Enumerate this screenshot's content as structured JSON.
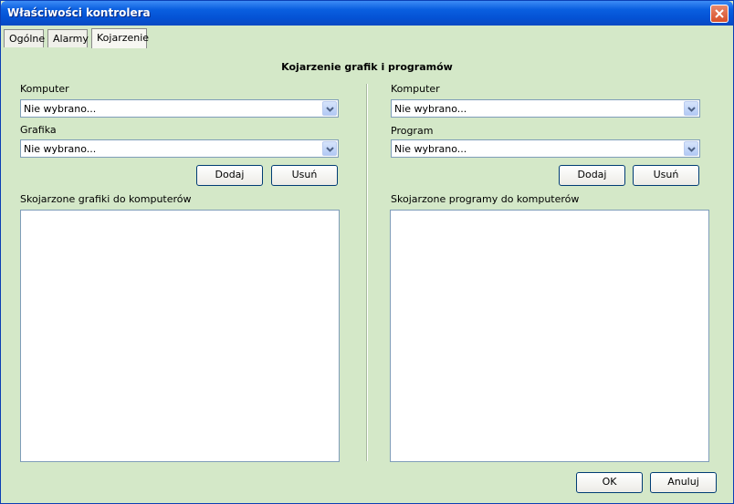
{
  "window": {
    "title": "Właściwości kontrolera"
  },
  "tabs": [
    {
      "label": "Ogólne"
    },
    {
      "label": "Alarmy"
    },
    {
      "label": "Kojarzenie"
    }
  ],
  "section_title": "Kojarzenie grafik i programów",
  "left": {
    "computer_label": "Komputer",
    "computer_value": "Nie wybrano...",
    "graphic_label": "Grafika",
    "graphic_value": "Nie wybrano...",
    "add_label": "Dodaj",
    "remove_label": "Usuń",
    "list_label": "Skojarzone grafiki do komputerów"
  },
  "right": {
    "computer_label": "Komputer",
    "computer_value": "Nie wybrano...",
    "program_label": "Program",
    "program_value": "Nie wybrano...",
    "add_label": "Dodaj",
    "remove_label": "Usuń",
    "list_label": "Skojarzone programy do komputerów"
  },
  "footer": {
    "ok_label": "OK",
    "cancel_label": "Anuluj"
  }
}
